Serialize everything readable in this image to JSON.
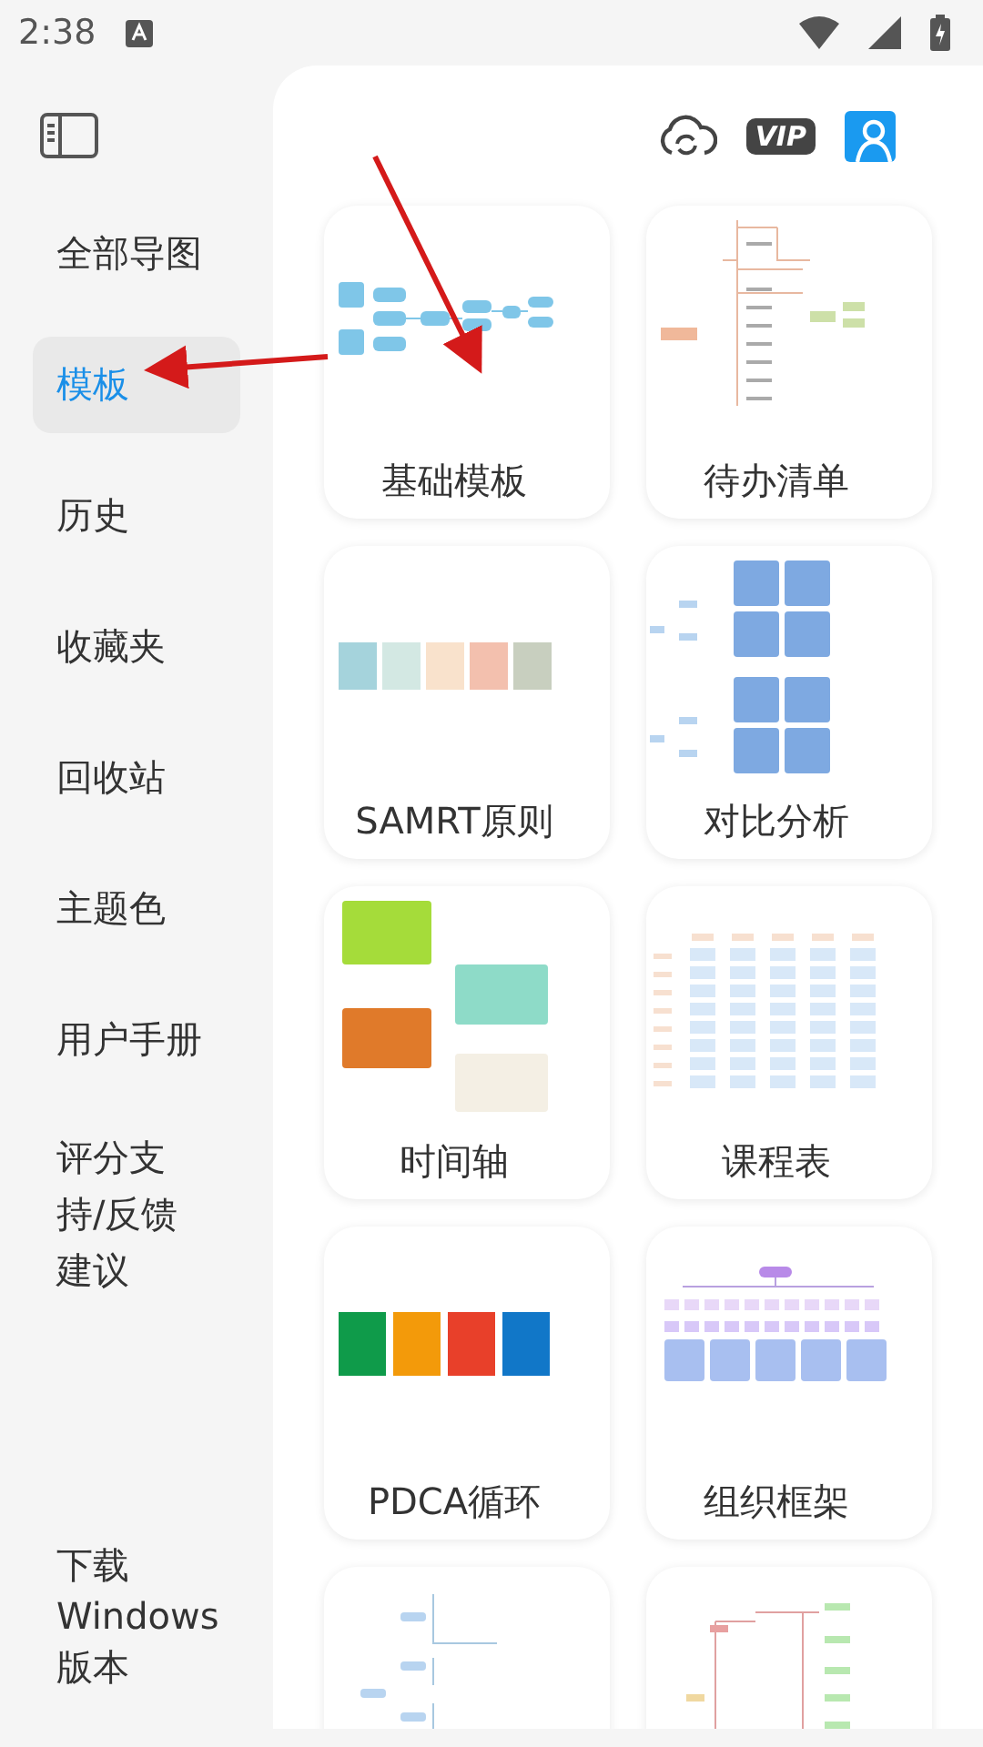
{
  "status_bar": {
    "time": "2:38"
  },
  "sidebar": {
    "items": [
      {
        "lines": [
          "全部导图"
        ],
        "selected": false
      },
      {
        "lines": [
          "模板"
        ],
        "selected": true
      },
      {
        "lines": [
          "历史"
        ],
        "selected": false
      },
      {
        "lines": [
          "收藏夹"
        ],
        "selected": false
      },
      {
        "lines": [
          "回收站"
        ],
        "selected": false
      },
      {
        "lines": [
          "主题色"
        ],
        "selected": false
      },
      {
        "lines": [
          "用户手册"
        ],
        "selected": false
      },
      {
        "lines": [
          "评分支",
          "持/反馈",
          "建议"
        ],
        "selected": false
      }
    ],
    "footer_item": {
      "lines": [
        "下载",
        "Windows",
        "版本"
      ]
    }
  },
  "header": {
    "vip_badge": "VIP"
  },
  "templates": [
    {
      "kind": "mindmap",
      "label": "基础模板"
    },
    {
      "kind": "todo",
      "label": "待办清单"
    },
    {
      "kind": "swatches",
      "label": "SAMRT原则"
    },
    {
      "kind": "compare",
      "label": "对比分析"
    },
    {
      "kind": "timeline",
      "label": "时间轴"
    },
    {
      "kind": "schedule",
      "label": "课程表"
    },
    {
      "kind": "pdca",
      "label": "PDCA循环"
    },
    {
      "kind": "org",
      "label": "组织框架"
    },
    {
      "kind": "outline"
    },
    {
      "kind": "flow"
    }
  ]
}
